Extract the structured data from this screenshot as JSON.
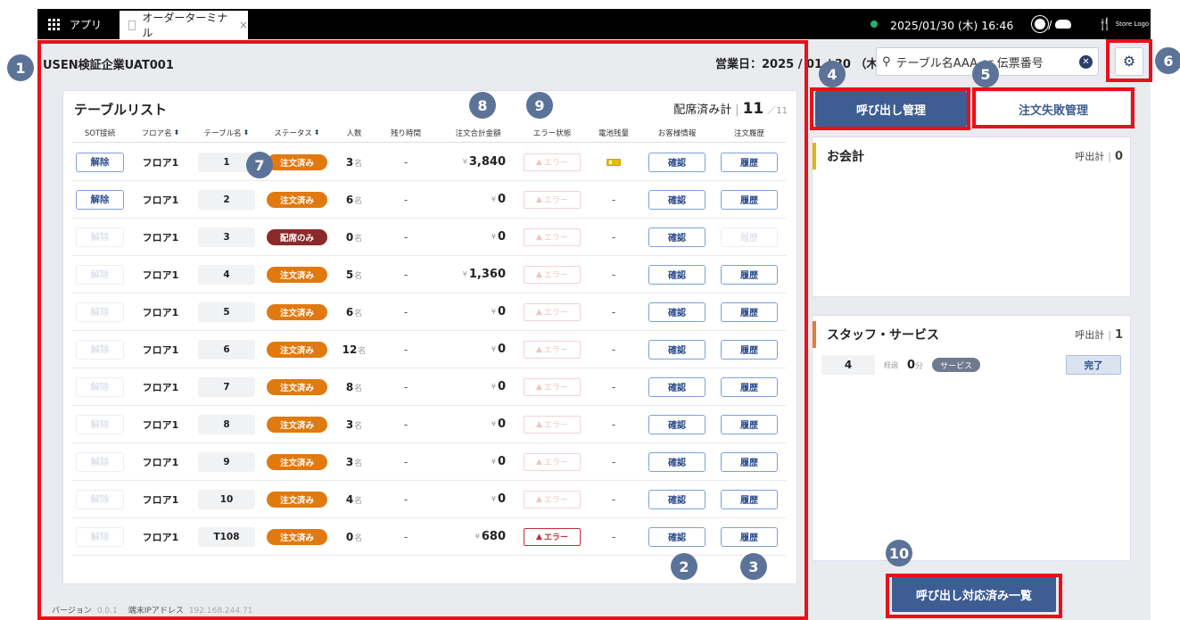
{
  "topbar": {
    "apps_label": "アプリ",
    "tab_label": "オーダーターミナル",
    "tab_close": "×",
    "datetime": "2025/01/30 (木) 16:46",
    "weather_sep": "/",
    "store_logo": "Store Logo"
  },
  "header": {
    "company": "USEN検証企業UAT001",
    "business_date": "営業日：2025 / 01 / 30 （木）",
    "search_placeholder": "テーブル名AAA or 伝票番号",
    "settings_icon": "gear-icon"
  },
  "table_list": {
    "title": "テーブルリスト",
    "seated_label": "配席済み計",
    "seated_sep": "|",
    "seated_count": "11",
    "seated_total": "／11",
    "headers": [
      "SOT接続",
      "フロア名",
      "テーブル名",
      "ステータス",
      "人数",
      "残り時間",
      "注文合計金額",
      "エラー状態",
      "電池残量",
      "お客様情報",
      "注文履歴"
    ],
    "sort_icon": "⬍",
    "yen": "¥",
    "guest_unit": "名",
    "rows": [
      {
        "release": "解除",
        "release_active": true,
        "floor": "フロア1",
        "table": "1",
        "status": "注文済み",
        "status_color": "#e07a10",
        "guests": "3",
        "remaining": "-",
        "amount": "3,840",
        "error": "エラー",
        "error_active": false,
        "battery": "low",
        "customer": "確認",
        "history": "履歴",
        "history_active": true
      },
      {
        "release": "解除",
        "release_active": true,
        "floor": "フロア1",
        "table": "2",
        "status": "注文済み",
        "status_color": "#e07a10",
        "guests": "6",
        "remaining": "-",
        "amount": "0",
        "error": "エラー",
        "error_active": false,
        "battery": "-",
        "customer": "確認",
        "history": "履歴",
        "history_active": true
      },
      {
        "release": "解除",
        "release_active": false,
        "floor": "フロア1",
        "table": "3",
        "status": "配席のみ",
        "status_color": "#8a2a2a",
        "guests": "0",
        "remaining": "-",
        "amount": "0",
        "error": "エラー",
        "error_active": false,
        "battery": "-",
        "customer": "確認",
        "history": "履歴",
        "history_active": false
      },
      {
        "release": "解除",
        "release_active": false,
        "floor": "フロア1",
        "table": "4",
        "status": "注文済み",
        "status_color": "#e07a10",
        "guests": "5",
        "remaining": "-",
        "amount": "1,360",
        "error": "エラー",
        "error_active": false,
        "battery": "-",
        "customer": "確認",
        "history": "履歴",
        "history_active": true
      },
      {
        "release": "解除",
        "release_active": false,
        "floor": "フロア1",
        "table": "5",
        "status": "注文済み",
        "status_color": "#e07a10",
        "guests": "6",
        "remaining": "-",
        "amount": "0",
        "error": "エラー",
        "error_active": false,
        "battery": "-",
        "customer": "確認",
        "history": "履歴",
        "history_active": true
      },
      {
        "release": "解除",
        "release_active": false,
        "floor": "フロア1",
        "table": "6",
        "status": "注文済み",
        "status_color": "#e07a10",
        "guests": "12",
        "remaining": "-",
        "amount": "0",
        "error": "エラー",
        "error_active": false,
        "battery": "-",
        "customer": "確認",
        "history": "履歴",
        "history_active": true
      },
      {
        "release": "解除",
        "release_active": false,
        "floor": "フロア1",
        "table": "7",
        "status": "注文済み",
        "status_color": "#e07a10",
        "guests": "8",
        "remaining": "-",
        "amount": "0",
        "error": "エラー",
        "error_active": false,
        "battery": "-",
        "customer": "確認",
        "history": "履歴",
        "history_active": true
      },
      {
        "release": "解除",
        "release_active": false,
        "floor": "フロア1",
        "table": "8",
        "status": "注文済み",
        "status_color": "#e07a10",
        "guests": "3",
        "remaining": "-",
        "amount": "0",
        "error": "エラー",
        "error_active": false,
        "battery": "-",
        "customer": "確認",
        "history": "履歴",
        "history_active": true
      },
      {
        "release": "解除",
        "release_active": false,
        "floor": "フロア1",
        "table": "9",
        "status": "注文済み",
        "status_color": "#e07a10",
        "guests": "3",
        "remaining": "-",
        "amount": "0",
        "error": "エラー",
        "error_active": false,
        "battery": "-",
        "customer": "確認",
        "history": "履歴",
        "history_active": true
      },
      {
        "release": "解除",
        "release_active": false,
        "floor": "フロア1",
        "table": "10",
        "status": "注文済み",
        "status_color": "#e07a10",
        "guests": "4",
        "remaining": "-",
        "amount": "0",
        "error": "エラー",
        "error_active": false,
        "battery": "-",
        "customer": "確認",
        "history": "履歴",
        "history_active": true
      },
      {
        "release": "解除",
        "release_active": false,
        "floor": "フロア1",
        "table": "T108",
        "status": "注文済み",
        "status_color": "#e07a10",
        "guests": "0",
        "remaining": "-",
        "amount": "680",
        "error": "エラー",
        "error_active": true,
        "battery": "-",
        "customer": "確認",
        "history": "履歴",
        "history_active": true
      }
    ]
  },
  "footer": {
    "version_label": "バージョン",
    "version": "0.0.1",
    "ip_label": "端末IPアドレス",
    "ip": "192.168.244.71"
  },
  "right_panel": {
    "call_tab": "呼び出し管理",
    "fail_tab": "注文失敗管理",
    "checkout": {
      "title": "お会計",
      "count_label": "呼出計",
      "sep": "|",
      "count": "0"
    },
    "staff": {
      "title": "スタッフ・サービス",
      "count_label": "呼出計",
      "sep": "|",
      "count": "1",
      "calls": [
        {
          "table": "4",
          "elapsed_label": "経過",
          "minutes": "0",
          "unit": "分",
          "tag": "サービス",
          "done": "完了"
        }
      ]
    },
    "handled_list_button": "呼び出し対応済み一覧"
  },
  "annotations": [
    "1",
    "2",
    "3",
    "4",
    "5",
    "6",
    "7",
    "8",
    "9",
    "10"
  ],
  "colors": {
    "accent": "#3e5d92",
    "highlight": "#e8101a",
    "ordered": "#e07a10",
    "seat_only": "#8a2a2a",
    "badge": "#5b7398"
  }
}
